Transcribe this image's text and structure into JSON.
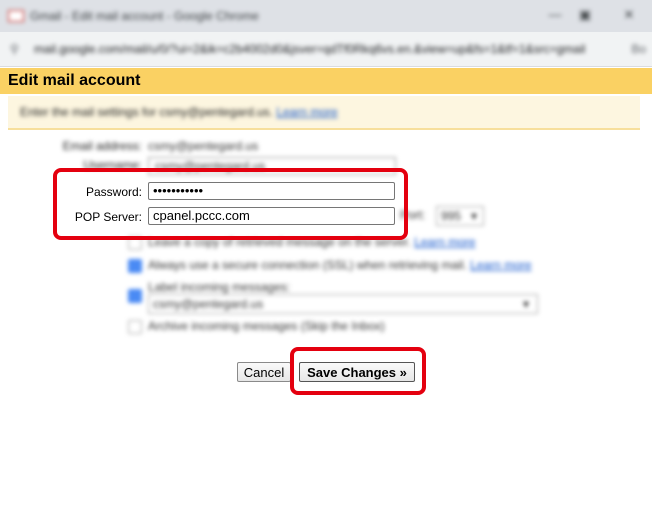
{
  "window": {
    "title": "Gmail - Edit mail account - Google Chrome",
    "url": "mail.google.com/mail/u/0/?ui=2&ik=c2b4002d0&jsver=qdTf0Rkq6vs.en.&view=up&fs=1&tf=1&src=gmail",
    "url_right": "Bo"
  },
  "page": {
    "title": "Edit mail account",
    "intro": "Enter the mail settings for csmy@pentegard.us.",
    "learn_more": "Learn more"
  },
  "form": {
    "email_label": "Email address:",
    "email_value": "csmy@pentegard.us",
    "username_label": "Username:",
    "username_value": "csmy@pentegard.us",
    "password_label": "Password:",
    "password_value": "•••••••••••",
    "pop_server_label": "POP Server:",
    "pop_server_value": "cpanel.pccc.com",
    "port_label": "Port:",
    "port_value": "995",
    "option_leave_copy": "Leave a copy of retrieved message on the server.",
    "option_ssl": "Always use a secure connection (SSL) when retrieving mail.",
    "option_label": "Label incoming messages:",
    "option_label_value": "csmy@pentegard.us",
    "option_archive": "Archive incoming messages (Skip the Inbox)",
    "learn_more": "Learn more"
  },
  "buttons": {
    "cancel": "Cancel",
    "save": "Save Changes »"
  },
  "colors": {
    "header": "#fad163",
    "highlight": "#e4000f"
  }
}
